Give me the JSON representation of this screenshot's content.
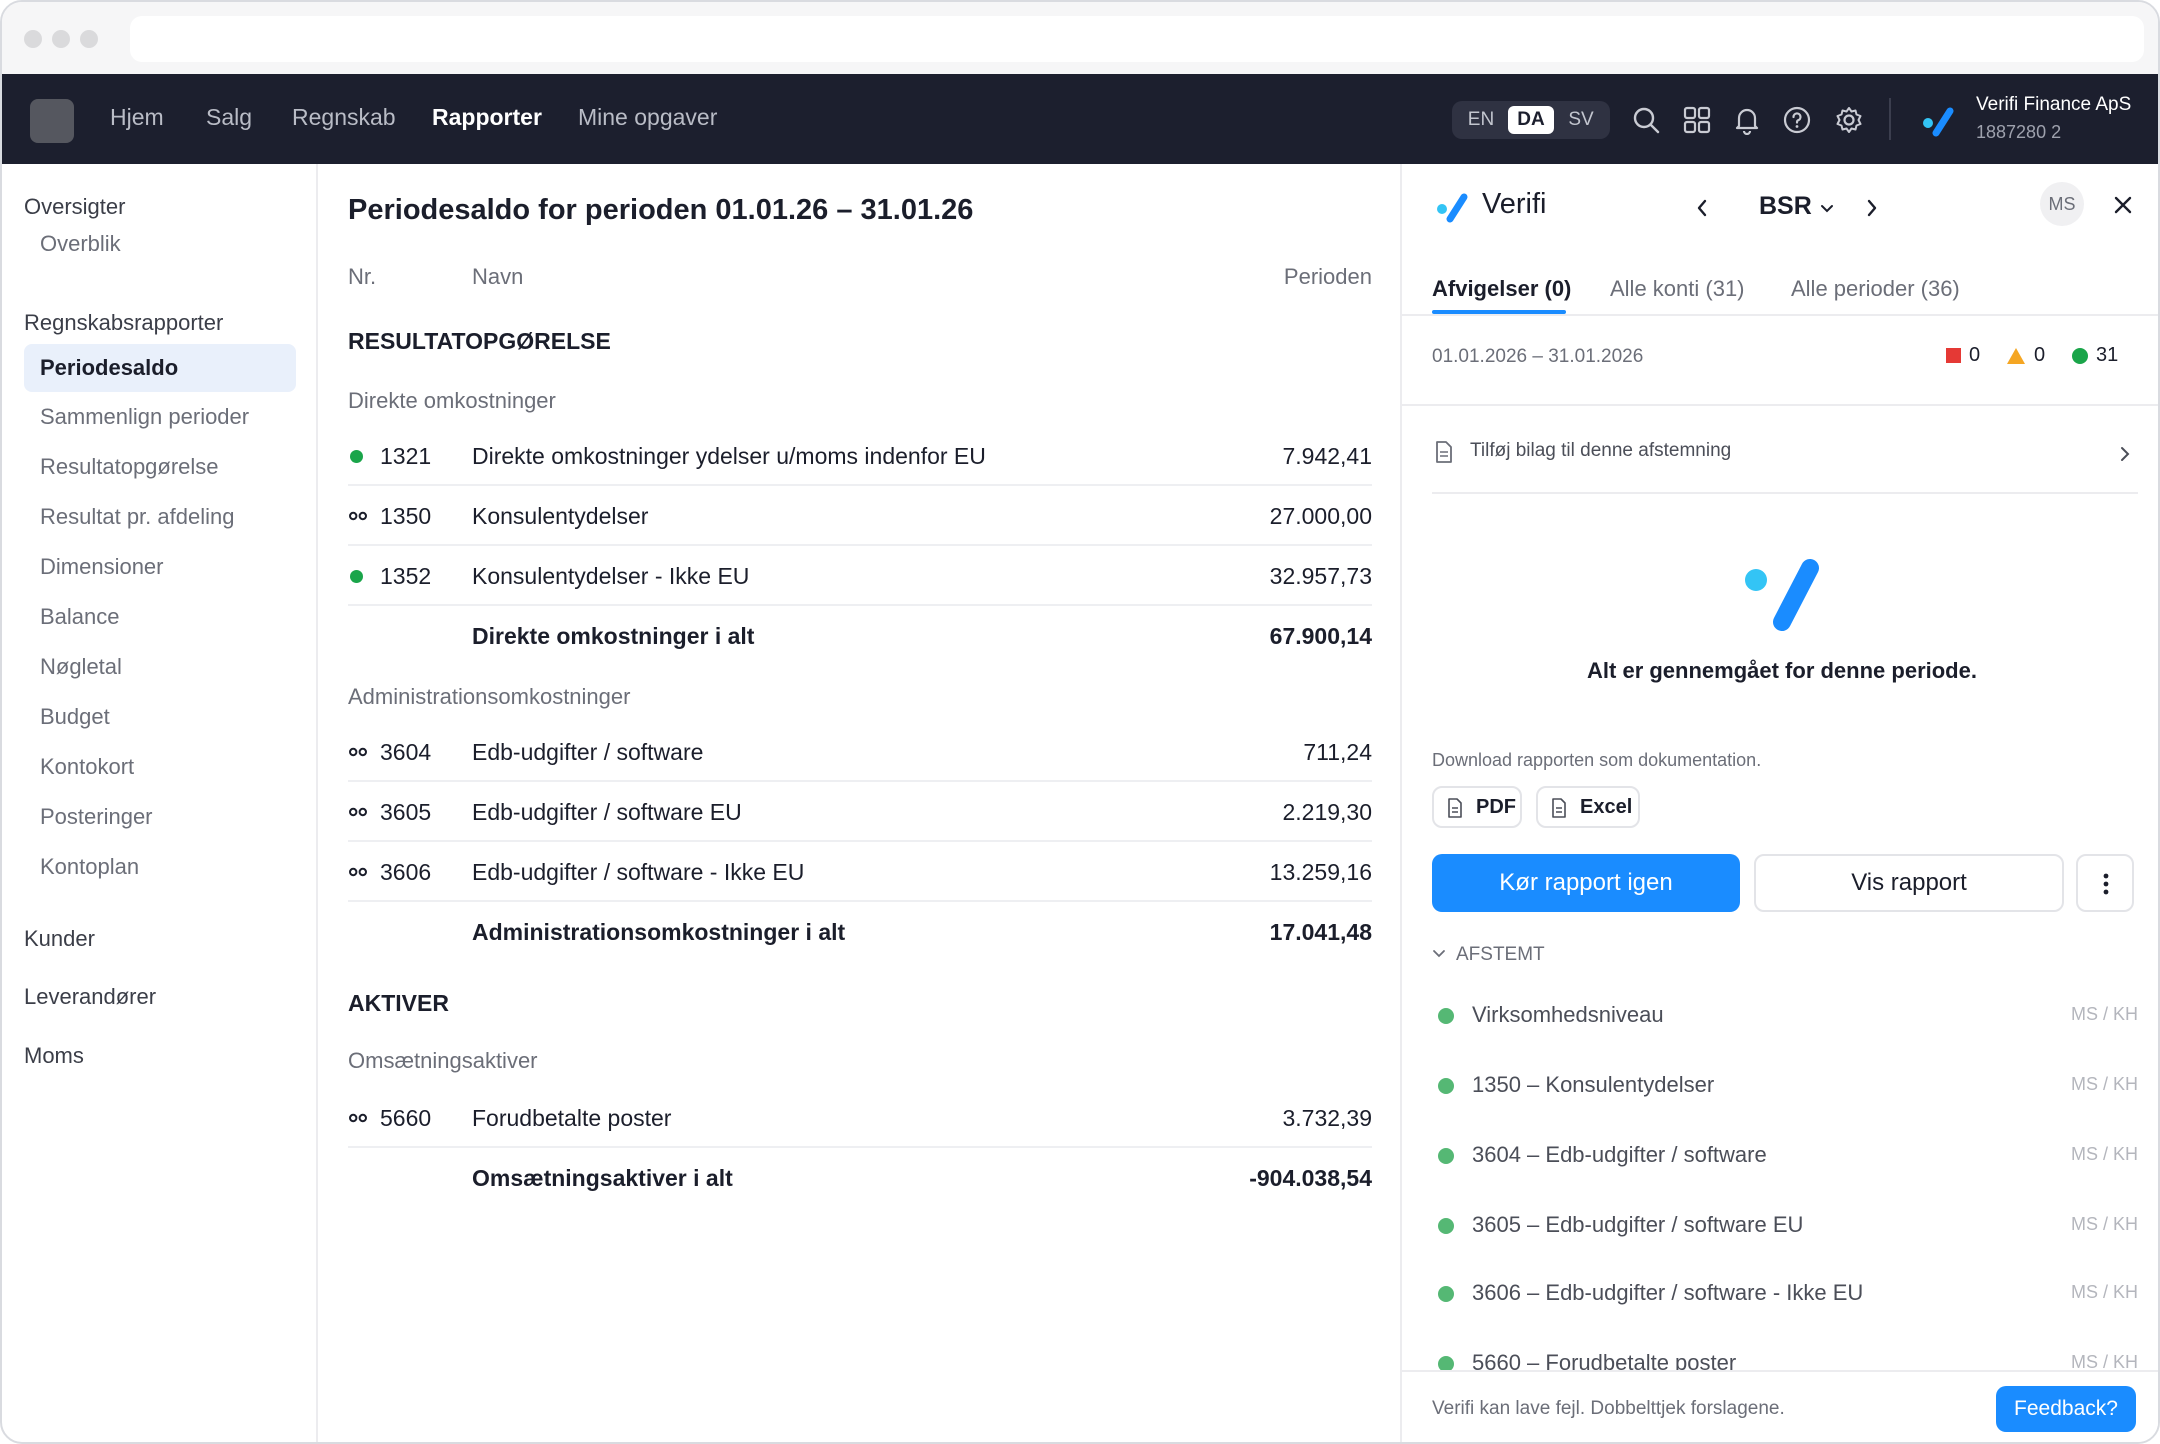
{
  "topnav": {
    "items": [
      "Hjem",
      "Salg",
      "Regnskab",
      "Rapporter",
      "Mine opgaver"
    ],
    "active_index": 3,
    "languages": [
      "EN",
      "DA",
      "SV"
    ],
    "active_language": "DA",
    "company_name": "Verifi Finance ApS",
    "company_id": "1887280 2"
  },
  "sidebar": {
    "head_oversigter": "Oversigter",
    "overblik": "Overblik",
    "head_regnskab": "Regnskabsrapporter",
    "items": [
      "Periodesaldo",
      "Sammenlign perioder",
      "Resultatopgørelse",
      "Resultat pr. afdeling",
      "Dimensioner",
      "Balance",
      "Nøgletal",
      "Budget",
      "Kontokort",
      "Posteringer",
      "Kontoplan"
    ],
    "active_item": "Periodesaldo",
    "kunder": "Kunder",
    "leverandorer": "Leverandører",
    "moms": "Moms"
  },
  "report": {
    "title": "Periodesaldo for perioden 01.01.26 – 31.01.26",
    "col_nr": "Nr.",
    "col_navn": "Navn",
    "col_perioden": "Perioden",
    "section_resultat": "RESULTATOPGØRELSE",
    "group_direkte": "Direkte omkostninger",
    "direkte_rows": [
      {
        "mark": "green-dot",
        "nr": "1321",
        "name": "Direkte omkostninger ydelser u/moms indenfor EU",
        "amount": "7.942,41"
      },
      {
        "mark": "link",
        "nr": "1350",
        "name": "Konsulentydelser",
        "amount": "27.000,00"
      },
      {
        "mark": "green-dot",
        "nr": "1352",
        "name": "Konsulentydelser - Ikke EU",
        "amount": "32.957,73"
      }
    ],
    "direkte_total": {
      "name": "Direkte omkostninger i alt",
      "amount": "67.900,14"
    },
    "group_admin": "Administrationsomkostninger",
    "admin_rows": [
      {
        "mark": "link",
        "nr": "3604",
        "name": "Edb-udgifter / software",
        "amount": "711,24"
      },
      {
        "mark": "link",
        "nr": "3605",
        "name": "Edb-udgifter / software EU",
        "amount": "2.219,30"
      },
      {
        "mark": "link",
        "nr": "3606",
        "name": "Edb-udgifter / software - Ikke EU",
        "amount": "13.259,16"
      }
    ],
    "admin_total": {
      "name": "Administrationsomkostninger i alt",
      "amount": "17.041,48"
    },
    "section_aktiver": "AKTIVER",
    "group_omsaetning": "Omsætningsaktiver",
    "omsaetning_rows": [
      {
        "mark": "link",
        "nr": "5660",
        "name": "Forudbetalte poster",
        "amount": "3.732,39"
      }
    ],
    "omsaetning_total": {
      "name": "Omsætningsaktiver i alt",
      "amount": "-904.038,54"
    }
  },
  "panel": {
    "title": "Verifi",
    "report_code": "BSR",
    "user_initials": "MS",
    "tabs": [
      "Afvigelser (0)",
      "Alle konti (31)",
      "Alle perioder (36)"
    ],
    "period": "01.01.2026 – 31.01.2026",
    "stats": {
      "red": "0",
      "orange": "0",
      "green": "31"
    },
    "attach_text": "Tilføj bilag til denne afstemning",
    "empty_message": "Alt er gennemgået for denne periode.",
    "download_text": "Download rapporten som dokumentation.",
    "pdf_label": "PDF",
    "excel_label": "Excel",
    "run_again": "Kør rapport igen",
    "show_report": "Vis rapport",
    "afstemt_label": "AFSTEMT",
    "reconciled": [
      {
        "label": "Virksomhedsniveau",
        "who": "MS / KH"
      },
      {
        "label": "1350 – Konsulentydelser",
        "who": "MS / KH"
      },
      {
        "label": "3604 – Edb-udgifter / software",
        "who": "MS / KH"
      },
      {
        "label": "3605 – Edb-udgifter / software EU",
        "who": "MS / KH"
      },
      {
        "label": "3606 – Edb-udgifter / software - Ikke EU",
        "who": "MS / KH"
      },
      {
        "label": "5660 – Forudbetalte poster",
        "who": "MS / KH"
      }
    ],
    "footer_note": "Verifi kan lave fejl. Dobbelttjek forslagene.",
    "feedback": "Feedback?"
  },
  "colors": {
    "nav_bg": "#1c1f2e",
    "accent_blue": "#1a8cff",
    "status_green": "#1aa54a",
    "status_red": "#e53935",
    "status_orange": "#f5a623"
  }
}
